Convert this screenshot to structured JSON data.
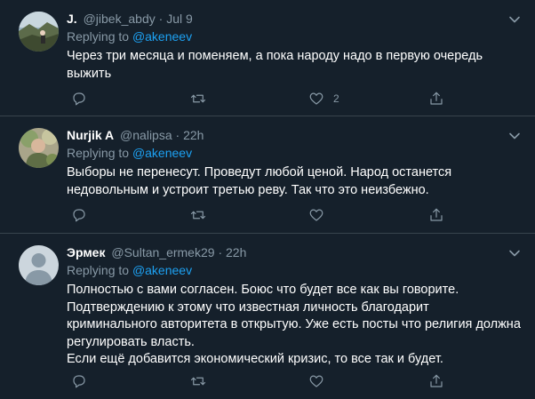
{
  "replying_label": "Replying to",
  "tweets": [
    {
      "name": "J.",
      "handle": "@jibek_abdy",
      "time": "Jul 9",
      "reply_to": "@akeneev",
      "text": "Через три месяца и поменяем, а пока народу надо в первую очередь выжить",
      "like_count": "2"
    },
    {
      "name": "Nurjik A",
      "handle": "@nalipsa",
      "time": "22h",
      "reply_to": "@akeneev",
      "text": "Выборы не перенесут. Проведут любой ценой. Народ останется недовольным и устроит третью реву. Так что это неизбежно.",
      "like_count": ""
    },
    {
      "name": "Эрмек",
      "handle": "@Sultan_ermek29",
      "time": "22h",
      "reply_to": "@akeneev",
      "text": "Полностью с вами согласен. Боюс что будет все как вы говорите.\nПодтверждению к этому что известная личность благодарит криминального авторитета в открытую. Уже есть посты что религия должна регулировать власть.\nЕсли ещё добавится экономический кризис, то все так и будет.",
      "like_count": ""
    }
  ],
  "separator": "·",
  "colors": {
    "background": "#15202b",
    "divider": "#38444d",
    "secondary_text": "#8899a6",
    "accent": "#1da1f2"
  },
  "icons": {
    "reply": "reply-icon",
    "retweet": "retweet-icon",
    "like": "heart-icon",
    "share": "share-icon",
    "more": "chevron-down-icon"
  }
}
